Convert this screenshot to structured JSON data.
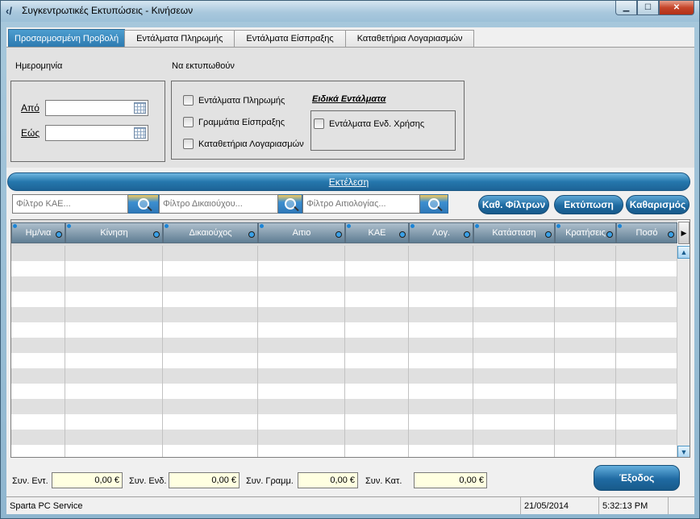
{
  "window": {
    "title": "Συγκεντρωτικές Εκτυπώσεις  - Κινήσεων",
    "controls": {
      "minimize": "▁",
      "maximize": "☐",
      "close": "✕"
    }
  },
  "tabs": [
    {
      "label": "Προσαρμοσμένη Προβολή",
      "active": true
    },
    {
      "label": "Εντάλματα Πληρωμής",
      "active": false
    },
    {
      "label": "Εντάλματα Είσπραξης",
      "active": false
    },
    {
      "label": "Καταθετήρια Λογαριασμών",
      "active": false
    }
  ],
  "date_section": {
    "title": "Ημερομηνία",
    "from_label": "Από",
    "to_label": "Εώς",
    "from_value": "",
    "to_value": ""
  },
  "print_section": {
    "title": "Να εκτυπωθούν",
    "options": [
      "Εντάλματα Πληρωμής",
      "Γραμμάτια Είσπραξης",
      "Καταθετήρια Λογαριασμών"
    ],
    "special_title": "Ειδικά Εντάλματα",
    "special_option": "Εντάλματα Ενδ. Χρήσης"
  },
  "run_label": "Εκτέλεση",
  "filters": {
    "kae_placeholder": "Φίλτρο ΚΑΕ...",
    "beneficiary_placeholder": "Φίλτρο Δικαιούχου...",
    "reason_placeholder": "Φίλτρο Αιτιολογίας..."
  },
  "buttons": {
    "clear_filters": "Καθ. Φίλτρων",
    "print": "Εκτύπωση",
    "clear": "Καθαρισμός",
    "exit": "Έξοδος"
  },
  "grid": {
    "columns": [
      "Ημ/νια",
      "Κίνηση",
      "Δικαιούχος",
      "Αιτιο",
      "ΚΑΕ",
      "Λογ.",
      "Κατάσταση",
      "Κρατήσεις",
      "Ποσό"
    ],
    "scroll_up": "▲",
    "scroll_down": "▼",
    "scroll_right": "▶"
  },
  "totals": [
    {
      "label": "Συν. Εντ.",
      "value": "0,00 €"
    },
    {
      "label": "Συν. Ενδ.",
      "value": "0,00 €"
    },
    {
      "label": "Συν. Γραμμ.",
      "value": "0,00 €"
    },
    {
      "label": "Συν. Κατ.",
      "value": "0,00 €"
    }
  ],
  "status": {
    "company": "Sparta PC Service",
    "date": "21/05/2014",
    "time": "5:32:13 PM"
  }
}
